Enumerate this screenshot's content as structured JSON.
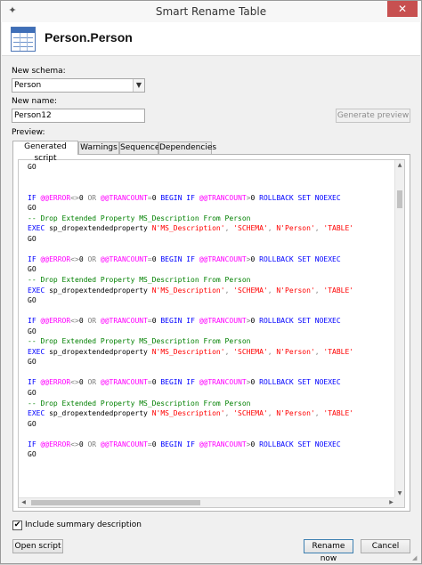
{
  "window": {
    "title": "Smart Rename Table",
    "close_glyph": "✕"
  },
  "header": {
    "title": "Person.Person",
    "icon": "table-icon"
  },
  "form": {
    "schema_label": "New schema:",
    "schema_value": "Person",
    "name_label": "New name:",
    "name_value": "Person12",
    "generate_label": "Generate preview",
    "preview_label": "Preview:"
  },
  "tabs": [
    {
      "label": "Generated script",
      "active": true
    },
    {
      "label": "Warnings",
      "active": false
    },
    {
      "label": "Sequence",
      "active": false
    },
    {
      "label": "Dependencies",
      "active": false
    }
  ],
  "script_lines": [
    [
      [
        "tx",
        "GO"
      ]
    ],
    [],
    [],
    [
      [
        "kw",
        "IF "
      ],
      [
        "gv",
        "@@ERROR"
      ],
      [
        "op",
        "<>"
      ],
      [
        "tx",
        "0 "
      ],
      [
        "op",
        "OR "
      ],
      [
        "gv",
        "@@TRANCOUNT"
      ],
      [
        "op",
        "="
      ],
      [
        "tx",
        "0 "
      ],
      [
        "kw",
        "BEGIN IF "
      ],
      [
        "gv",
        "@@TRANCOUNT"
      ],
      [
        "op",
        ">"
      ],
      [
        "tx",
        "0 "
      ],
      [
        "kw",
        "ROLLBACK SET NOEXEC"
      ]
    ],
    [
      [
        "tx",
        "GO"
      ]
    ],
    [
      [
        "cm",
        "-- Drop Extended Property MS_Description From Person"
      ]
    ],
    [
      [
        "kw",
        "EXEC "
      ],
      [
        "tx",
        "sp_dropextendedproperty "
      ],
      [
        "st",
        "N'MS_Description'"
      ],
      [
        "op",
        ", "
      ],
      [
        "st",
        "'SCHEMA'"
      ],
      [
        "op",
        ", "
      ],
      [
        "st",
        "N'Person'"
      ],
      [
        "op",
        ", "
      ],
      [
        "st",
        "'TABLE'"
      ]
    ],
    [
      [
        "tx",
        "GO"
      ]
    ],
    [],
    [
      [
        "kw",
        "IF "
      ],
      [
        "gv",
        "@@ERROR"
      ],
      [
        "op",
        "<>"
      ],
      [
        "tx",
        "0 "
      ],
      [
        "op",
        "OR "
      ],
      [
        "gv",
        "@@TRANCOUNT"
      ],
      [
        "op",
        "="
      ],
      [
        "tx",
        "0 "
      ],
      [
        "kw",
        "BEGIN IF "
      ],
      [
        "gv",
        "@@TRANCOUNT"
      ],
      [
        "op",
        ">"
      ],
      [
        "tx",
        "0 "
      ],
      [
        "kw",
        "ROLLBACK SET NOEXEC"
      ]
    ],
    [
      [
        "tx",
        "GO"
      ]
    ],
    [
      [
        "cm",
        "-- Drop Extended Property MS_Description From Person"
      ]
    ],
    [
      [
        "kw",
        "EXEC "
      ],
      [
        "tx",
        "sp_dropextendedproperty "
      ],
      [
        "st",
        "N'MS_Description'"
      ],
      [
        "op",
        ", "
      ],
      [
        "st",
        "'SCHEMA'"
      ],
      [
        "op",
        ", "
      ],
      [
        "st",
        "N'Person'"
      ],
      [
        "op",
        ", "
      ],
      [
        "st",
        "'TABLE'"
      ]
    ],
    [
      [
        "tx",
        "GO"
      ]
    ],
    [],
    [
      [
        "kw",
        "IF "
      ],
      [
        "gv",
        "@@ERROR"
      ],
      [
        "op",
        "<>"
      ],
      [
        "tx",
        "0 "
      ],
      [
        "op",
        "OR "
      ],
      [
        "gv",
        "@@TRANCOUNT"
      ],
      [
        "op",
        "="
      ],
      [
        "tx",
        "0 "
      ],
      [
        "kw",
        "BEGIN IF "
      ],
      [
        "gv",
        "@@TRANCOUNT"
      ],
      [
        "op",
        ">"
      ],
      [
        "tx",
        "0 "
      ],
      [
        "kw",
        "ROLLBACK SET NOEXEC"
      ]
    ],
    [
      [
        "tx",
        "GO"
      ]
    ],
    [
      [
        "cm",
        "-- Drop Extended Property MS_Description From Person"
      ]
    ],
    [
      [
        "kw",
        "EXEC "
      ],
      [
        "tx",
        "sp_dropextendedproperty "
      ],
      [
        "st",
        "N'MS_Description'"
      ],
      [
        "op",
        ", "
      ],
      [
        "st",
        "'SCHEMA'"
      ],
      [
        "op",
        ", "
      ],
      [
        "st",
        "N'Person'"
      ],
      [
        "op",
        ", "
      ],
      [
        "st",
        "'TABLE'"
      ]
    ],
    [
      [
        "tx",
        "GO"
      ]
    ],
    [],
    [
      [
        "kw",
        "IF "
      ],
      [
        "gv",
        "@@ERROR"
      ],
      [
        "op",
        "<>"
      ],
      [
        "tx",
        "0 "
      ],
      [
        "op",
        "OR "
      ],
      [
        "gv",
        "@@TRANCOUNT"
      ],
      [
        "op",
        "="
      ],
      [
        "tx",
        "0 "
      ],
      [
        "kw",
        "BEGIN IF "
      ],
      [
        "gv",
        "@@TRANCOUNT"
      ],
      [
        "op",
        ">"
      ],
      [
        "tx",
        "0 "
      ],
      [
        "kw",
        "ROLLBACK SET NOEXEC"
      ]
    ],
    [
      [
        "tx",
        "GO"
      ]
    ],
    [
      [
        "cm",
        "-- Drop Extended Property MS_Description From Person"
      ]
    ],
    [
      [
        "kw",
        "EXEC "
      ],
      [
        "tx",
        "sp_dropextendedproperty "
      ],
      [
        "st",
        "N'MS_Description'"
      ],
      [
        "op",
        ", "
      ],
      [
        "st",
        "'SCHEMA'"
      ],
      [
        "op",
        ", "
      ],
      [
        "st",
        "N'Person'"
      ],
      [
        "op",
        ", "
      ],
      [
        "st",
        "'TABLE'"
      ]
    ],
    [
      [
        "tx",
        "GO"
      ]
    ],
    [],
    [
      [
        "kw",
        "IF "
      ],
      [
        "gv",
        "@@ERROR"
      ],
      [
        "op",
        "<>"
      ],
      [
        "tx",
        "0 "
      ],
      [
        "op",
        "OR "
      ],
      [
        "gv",
        "@@TRANCOUNT"
      ],
      [
        "op",
        "="
      ],
      [
        "tx",
        "0 "
      ],
      [
        "kw",
        "BEGIN IF "
      ],
      [
        "gv",
        "@@TRANCOUNT"
      ],
      [
        "op",
        ">"
      ],
      [
        "tx",
        "0 "
      ],
      [
        "kw",
        "ROLLBACK SET NOEXEC"
      ]
    ],
    [
      [
        "tx",
        "GO"
      ]
    ]
  ],
  "footer": {
    "include_summary_label": "Include summary description",
    "include_summary_checked": true,
    "check_glyph": "✔",
    "open_script_label": "Open script",
    "rename_now_label": "Rename now",
    "cancel_label": "Cancel"
  },
  "colors": {
    "keyword": "#0000ff",
    "global_var": "#ff00ff",
    "operator": "#808080",
    "comment": "#008000",
    "string": "#ff0000",
    "close_button": "#c75050"
  }
}
